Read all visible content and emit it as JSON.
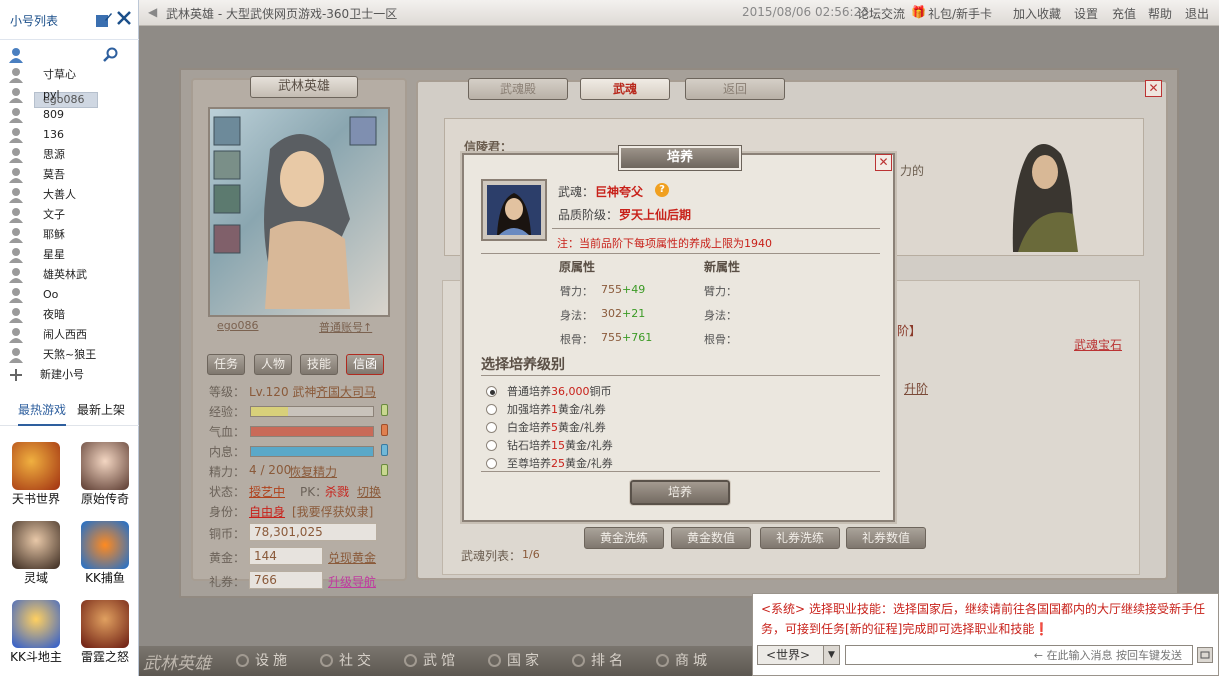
{
  "sidebar": {
    "title": "小号列表",
    "selected_account": "ego086",
    "accounts": [
      "寸草心",
      "pyl",
      "809",
      "136",
      "思源",
      "莫吾",
      "大善人",
      "文子",
      "耶稣",
      "星星",
      "雄英林武",
      "Oo",
      "夜暗",
      "闹人西西",
      "天煞~狼王"
    ],
    "new_account": "新建小号",
    "tabs": [
      "最热游戏",
      "最新上架"
    ],
    "games": [
      "天书世界",
      "原始传奇",
      "灵域",
      "KK捕鱼",
      "KK斗地主",
      "雷霆之怒"
    ]
  },
  "topbar": {
    "title": "武林英雄 - 大型武侠网页游戏-360卫士一区",
    "datetime": "2015/08/06 02:56:23",
    "links": [
      "论坛交流",
      "礼包/新手卡",
      "加入收藏",
      "设置",
      "充值",
      "帮助",
      "退出"
    ]
  },
  "character": {
    "panel_title": "武林英雄",
    "name": "ego086",
    "account_type": "普通账号↑",
    "tabs": [
      "任务",
      "人物",
      "技能",
      "信函"
    ],
    "level_label": "等级：",
    "level_value": "Lv.120 武神",
    "kingdom": "齐国大司马",
    "exp_label": "经验：",
    "hp_label": "气血：",
    "mp_label": "内息：",
    "energy_label": "精力：",
    "energy_value": "4 / 200",
    "energy_link": "恢复精力",
    "status_label": "状态：",
    "status_value": "授艺中",
    "pk_label": "PK：",
    "pk_value": "杀戮",
    "pk_switch": "切换",
    "identity_label": "身份：",
    "identity_value": "自由身",
    "identity_link": "[我要俘获奴隶]",
    "copper_label": "铜币：",
    "copper_value": "78,301,025",
    "gold_label": "黄金：",
    "gold_value": "144",
    "gold_link": "兑现黄金",
    "ticket_label": "礼券：",
    "ticket_value": "766",
    "ticket_link": "升级导航",
    "exp_fill": 0.3,
    "hp_fill": 1.0,
    "mp_fill": 1.0
  },
  "soul_panel": {
    "tabs": [
      "武魂殿",
      "武魂",
      "返回"
    ],
    "npc_name": "信陵君：",
    "npc_text_tail": "力的",
    "right_link": "武魂宝石",
    "right_text": "进阶】",
    "upgrade_link": "升阶",
    "bottom_buttons": [
      "黄金洗练",
      "黄金数值",
      "礼券洗练",
      "礼券数值"
    ],
    "list_label": "武魂列表：",
    "list_page": "1/6"
  },
  "dialog": {
    "title": "培养",
    "soul_label": "武魂：",
    "soul_name": "巨神夸父",
    "grade_label": "品质阶级：",
    "grade_value": "罗天上仙后期",
    "note": "注：当前品阶下每项属性的养成上限为1940",
    "orig_header": "原属性",
    "new_header": "新属性",
    "attrs": [
      {
        "label": "臂力：",
        "value": "755",
        "delta": "+49"
      },
      {
        "label": "身法：",
        "value": "302",
        "delta": "+21"
      },
      {
        "label": "根骨：",
        "value": "755",
        "delta": "+761"
      }
    ],
    "new_attrs": [
      "臂力：",
      "身法：",
      "根骨："
    ],
    "level_title": "选择培养级别",
    "options": [
      {
        "name": "普通培养",
        "cost": "36,000",
        "unit": "铜币"
      },
      {
        "name": "加强培养",
        "cost": "1",
        "unit": "黄金/礼券"
      },
      {
        "name": "白金培养",
        "cost": "5",
        "unit": "黄金/礼券"
      },
      {
        "name": "钻石培养",
        "cost": "15",
        "unit": "黄金/礼券"
      },
      {
        "name": "至尊培养",
        "cost": "25",
        "unit": "黄金/礼券"
      }
    ],
    "confirm": "培养"
  },
  "bottom": {
    "logo": "武林英雄",
    "nav": [
      "设施",
      "社交",
      "武馆",
      "国家",
      "排名",
      "商城"
    ]
  },
  "chat": {
    "message_prefix": "<系统>",
    "message": "选择职业技能：选择国家后，继续请前往各国国都内的大厅继续接受新手任务，可接到任务[新的征程]完成即可选择职业和技能",
    "channel": "<世界>",
    "placeholder": "← 在此输入消息 按回车键发送"
  },
  "colors": {
    "accent_red": "#c8211a",
    "green": "#3b9a25",
    "panel": "#d2cdc6"
  }
}
